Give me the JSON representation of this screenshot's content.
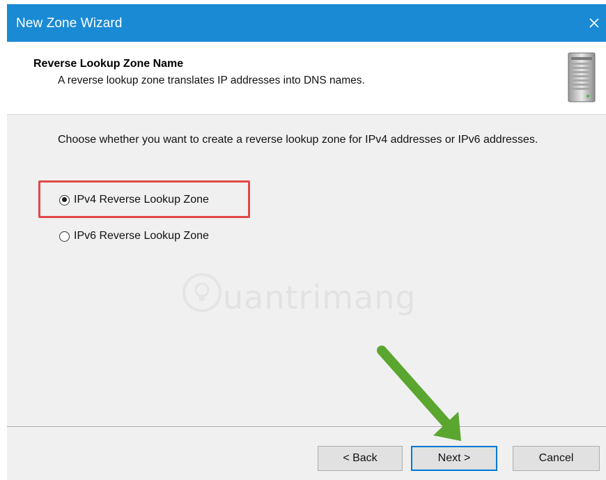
{
  "window": {
    "title": "New Zone Wizard",
    "close_icon": "close-icon"
  },
  "header": {
    "title": "Reverse Lookup Zone Name",
    "subtitle": "A reverse lookup zone translates IP addresses into DNS names.",
    "icon": "server-icon"
  },
  "body": {
    "instruction": "Choose whether you want to create a reverse lookup zone for IPv4 addresses or IPv6 addresses.",
    "options": [
      {
        "label": "IPv4 Reverse Lookup Zone",
        "selected": true
      },
      {
        "label": "IPv6 Reverse Lookup Zone",
        "selected": false
      }
    ]
  },
  "annotations": {
    "highlight_color": "#e34848",
    "arrow_color": "#5aa62f"
  },
  "watermark": {
    "text": "uantrimang",
    "icon": "lightbulb-icon"
  },
  "buttons": {
    "back": "< Back",
    "next": "Next >",
    "cancel": "Cancel"
  },
  "colors": {
    "titlebar": "#1a8ad4",
    "focus": "#0078d7"
  }
}
